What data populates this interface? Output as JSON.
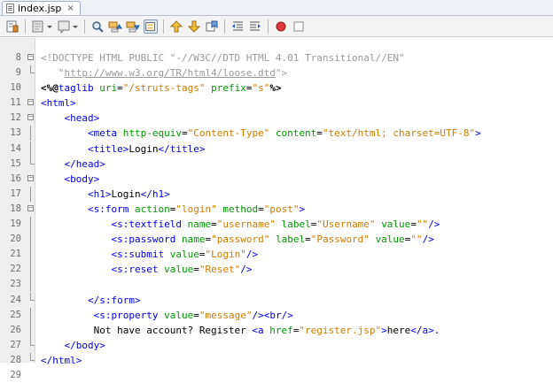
{
  "tab": {
    "title": "index.jsp",
    "close": "×"
  },
  "toolbar": {
    "buttons": [
      "last-edit-icon",
      "back-icon",
      "forward-icon",
      "find-selection-icon",
      "find-previous-icon",
      "find-next-icon",
      "toggle-highlight-icon",
      "previous-bookmark-icon",
      "next-bookmark-icon",
      "toggle-bookmark-icon",
      "shift-left-icon",
      "shift-right-icon",
      "start-macro-icon",
      "stop-macro-icon"
    ]
  },
  "colors": {
    "tag": "#0000e6",
    "attribute": "#009900",
    "value": "#ce7b00",
    "doctype": "#999999",
    "gutter": "#eeeeee"
  },
  "editor": {
    "lines": [
      {
        "num": "8",
        "fold": "open",
        "indent": 0,
        "tokens": [
          [
            "doc",
            "<!DOCTYPE HTML PUBLIC \"-//W3C//DTD HTML 4.01 Transitional//EN\""
          ]
        ]
      },
      {
        "num": "9",
        "fold": "end",
        "indent": 0,
        "tokens": [
          [
            "doc",
            "   \""
          ],
          [
            "url",
            "http://www.w3.org/TR/html4/loose.dtd"
          ],
          [
            "doc",
            "\">"
          ]
        ]
      },
      {
        "num": "10",
        "fold": "",
        "indent": 0,
        "tokens": [
          [
            "dir",
            "<%@"
          ],
          [
            "tag",
            "taglib"
          ],
          [
            "txt",
            " "
          ],
          [
            "attr",
            "uri"
          ],
          [
            "txt",
            "="
          ],
          [
            "val",
            "\"/struts-tags\""
          ],
          [
            "txt",
            " "
          ],
          [
            "attr",
            "prefix"
          ],
          [
            "txt",
            "="
          ],
          [
            "val",
            "\"s\""
          ],
          [
            "dir",
            "%>"
          ]
        ]
      },
      {
        "num": "11",
        "fold": "open",
        "indent": 0,
        "tokens": [
          [
            "tag",
            "<html>"
          ]
        ]
      },
      {
        "num": "12",
        "fold": "open",
        "indent": 1,
        "tokens": [
          [
            "tag",
            "<head>"
          ]
        ]
      },
      {
        "num": "13",
        "fold": "line",
        "indent": 2,
        "tokens": [
          [
            "tag",
            "<meta"
          ],
          [
            "txt",
            " "
          ],
          [
            "attr",
            "http-equiv"
          ],
          [
            "txt",
            "="
          ],
          [
            "val",
            "\"Content-Type\""
          ],
          [
            "txt",
            " "
          ],
          [
            "attr",
            "content"
          ],
          [
            "txt",
            "="
          ],
          [
            "val",
            "\"text/html; charset=UTF-8\""
          ],
          [
            "tag",
            ">"
          ]
        ]
      },
      {
        "num": "14",
        "fold": "line",
        "indent": 2,
        "tokens": [
          [
            "tag",
            "<title>"
          ],
          [
            "txt",
            "Login"
          ],
          [
            "tag",
            "</title>"
          ]
        ]
      },
      {
        "num": "15",
        "fold": "end",
        "indent": 1,
        "tokens": [
          [
            "tag",
            "</head>"
          ]
        ]
      },
      {
        "num": "16",
        "fold": "open",
        "indent": 1,
        "tokens": [
          [
            "tag",
            "<body>"
          ]
        ]
      },
      {
        "num": "17",
        "fold": "line",
        "indent": 2,
        "tokens": [
          [
            "tag",
            "<h1>"
          ],
          [
            "txt",
            "Login"
          ],
          [
            "tag",
            "</h1>"
          ]
        ]
      },
      {
        "num": "18",
        "fold": "open",
        "indent": 2,
        "tokens": [
          [
            "tag",
            "<s:form"
          ],
          [
            "txt",
            " "
          ],
          [
            "attr",
            "action"
          ],
          [
            "txt",
            "="
          ],
          [
            "val",
            "\"login\""
          ],
          [
            "txt",
            " "
          ],
          [
            "attr",
            "method"
          ],
          [
            "txt",
            "="
          ],
          [
            "val",
            "\"post\""
          ],
          [
            "tag",
            ">"
          ]
        ]
      },
      {
        "num": "19",
        "fold": "line",
        "indent": 3,
        "tokens": [
          [
            "tag",
            "<s:textfield"
          ],
          [
            "txt",
            " "
          ],
          [
            "attr",
            "name"
          ],
          [
            "txt",
            "="
          ],
          [
            "val",
            "\"username\""
          ],
          [
            "txt",
            " "
          ],
          [
            "attr",
            "label"
          ],
          [
            "txt",
            "="
          ],
          [
            "val",
            "\"Username\""
          ],
          [
            "txt",
            " "
          ],
          [
            "attr",
            "value"
          ],
          [
            "txt",
            "="
          ],
          [
            "val",
            "\"\""
          ],
          [
            "tag",
            "/>"
          ]
        ]
      },
      {
        "num": "20",
        "fold": "line",
        "indent": 3,
        "tokens": [
          [
            "tag",
            "<s:password"
          ],
          [
            "txt",
            " "
          ],
          [
            "attr",
            "name"
          ],
          [
            "txt",
            "="
          ],
          [
            "val",
            "\"password\""
          ],
          [
            "txt",
            " "
          ],
          [
            "attr",
            "label"
          ],
          [
            "txt",
            "="
          ],
          [
            "val",
            "\"Password\""
          ],
          [
            "txt",
            " "
          ],
          [
            "attr",
            "value"
          ],
          [
            "txt",
            "="
          ],
          [
            "val",
            "\"\""
          ],
          [
            "tag",
            "/>"
          ]
        ]
      },
      {
        "num": "21",
        "fold": "line",
        "indent": 3,
        "tokens": [
          [
            "tag",
            "<s:submit"
          ],
          [
            "txt",
            " "
          ],
          [
            "attr",
            "value"
          ],
          [
            "txt",
            "="
          ],
          [
            "val",
            "\"Login\""
          ],
          [
            "tag",
            "/>"
          ]
        ]
      },
      {
        "num": "22",
        "fold": "line",
        "indent": 3,
        "tokens": [
          [
            "tag",
            "<s:reset"
          ],
          [
            "txt",
            " "
          ],
          [
            "attr",
            "value"
          ],
          [
            "txt",
            "="
          ],
          [
            "val",
            "\"Reset\""
          ],
          [
            "tag",
            "/>"
          ]
        ]
      },
      {
        "num": "23",
        "fold": "line",
        "indent": 0,
        "tokens": []
      },
      {
        "num": "24",
        "fold": "end",
        "indent": 2,
        "tokens": [
          [
            "tag",
            "</s:form>"
          ]
        ]
      },
      {
        "num": "25",
        "fold": "line",
        "indent": 2,
        "tokens": [
          [
            "txt",
            " "
          ],
          [
            "tag",
            "<s:property"
          ],
          [
            "txt",
            " "
          ],
          [
            "attr",
            "value"
          ],
          [
            "txt",
            "="
          ],
          [
            "val",
            "\"message\""
          ],
          [
            "tag",
            "/><br/>"
          ]
        ]
      },
      {
        "num": "26",
        "fold": "line",
        "indent": 2,
        "tokens": [
          [
            "txt",
            " Not have account? Register "
          ],
          [
            "tag",
            "<a"
          ],
          [
            "txt",
            " "
          ],
          [
            "attr",
            "href"
          ],
          [
            "txt",
            "="
          ],
          [
            "val",
            "\"register.jsp\""
          ],
          [
            "tag",
            ">"
          ],
          [
            "txt",
            "here"
          ],
          [
            "tag",
            "</a>"
          ],
          [
            "txt",
            "."
          ]
        ]
      },
      {
        "num": "27",
        "fold": "end",
        "indent": 1,
        "tokens": [
          [
            "tag",
            "</body>"
          ]
        ]
      },
      {
        "num": "28",
        "fold": "end",
        "indent": 0,
        "tokens": [
          [
            "tag",
            "</html>"
          ]
        ]
      },
      {
        "num": "29",
        "fold": "",
        "indent": 0,
        "tokens": []
      }
    ]
  }
}
